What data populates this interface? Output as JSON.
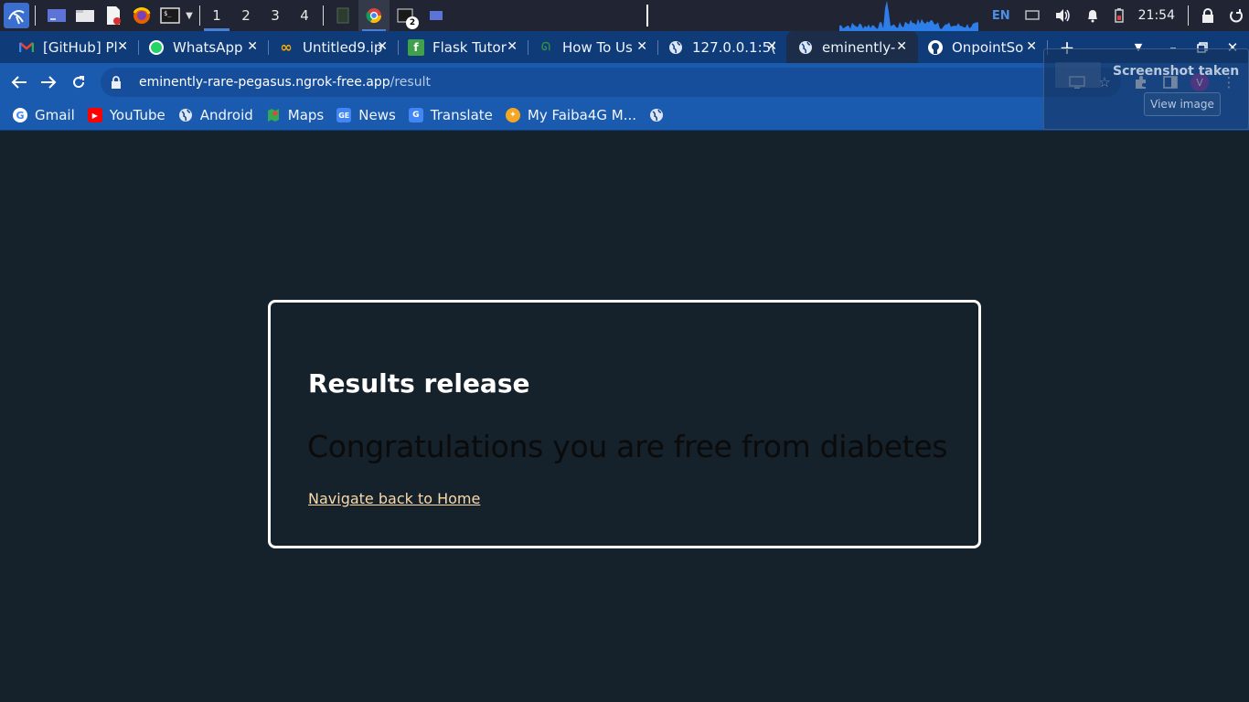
{
  "taskbar": {
    "workspaces": [
      "1",
      "2",
      "3",
      "4"
    ],
    "active_workspace": "1",
    "terminal_badge": "2",
    "language": "EN",
    "time": "21:54"
  },
  "browser": {
    "tabs": [
      {
        "label": "[GitHub] Pl",
        "icon": "gmail-icon"
      },
      {
        "label": "WhatsApp",
        "icon": "whatsapp-icon"
      },
      {
        "label": "Untitled9.ip",
        "icon": "colab-icon"
      },
      {
        "label": "Flask Tutor",
        "icon": "flask-tutorial-icon"
      },
      {
        "label": "How To Us",
        "icon": "geeksforgeeks-icon"
      },
      {
        "label": "127.0.0.1:5(",
        "icon": "globe-icon"
      },
      {
        "label": "eminently-",
        "icon": "globe-icon",
        "active": true
      },
      {
        "label": "OnpointSo",
        "icon": "github-icon"
      }
    ],
    "url_host": "eminently-rare-pegasus.ngrok-free.app",
    "url_path": "/result",
    "profile_initial": "V",
    "bookmarks": [
      {
        "label": "Gmail",
        "icon": "google-icon"
      },
      {
        "label": "YouTube",
        "icon": "youtube-icon"
      },
      {
        "label": "Android",
        "icon": "globe-icon"
      },
      {
        "label": "Maps",
        "icon": "maps-icon"
      },
      {
        "label": "News",
        "icon": "news-icon"
      },
      {
        "label": "Translate",
        "icon": "translate-icon"
      },
      {
        "label": "My Faiba4G M...",
        "icon": "faiba-icon"
      },
      {
        "label": "",
        "icon": "globe-icon"
      }
    ]
  },
  "notification": {
    "title": "Screenshot taken",
    "button": "View image"
  },
  "page": {
    "title": "Results release",
    "message": "Congratulations you are free from diabetes",
    "link": "Navigate back to Home"
  },
  "colors": {
    "page_background": "#15212b",
    "card_border": "#ffffff",
    "link": "#fbd9a8",
    "tabstrip": "#0f3b78",
    "toolbar": "#1a5aaf"
  }
}
